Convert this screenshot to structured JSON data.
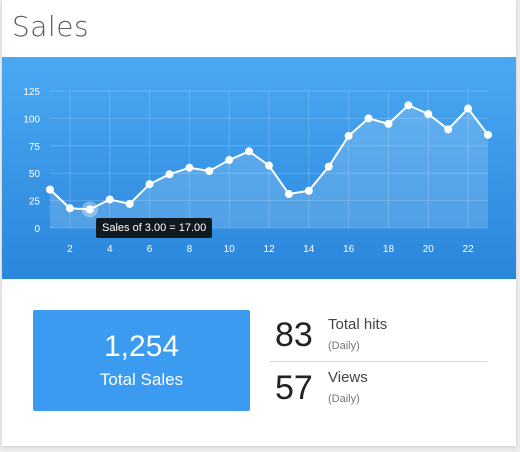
{
  "card": {
    "title": "Sales"
  },
  "chart_data": {
    "type": "area",
    "x": [
      1,
      2,
      3,
      4,
      5,
      6,
      7,
      8,
      9,
      10,
      11,
      12,
      13,
      14,
      15,
      16,
      17,
      18,
      19,
      20,
      21,
      22,
      23
    ],
    "values": [
      35,
      18,
      17,
      26,
      22,
      40,
      49,
      55,
      52,
      62,
      70,
      57,
      31,
      34,
      56,
      84,
      100,
      95,
      112,
      104,
      90,
      109,
      85
    ],
    "x_ticks": [
      2,
      4,
      6,
      8,
      10,
      12,
      14,
      16,
      18,
      20,
      22
    ],
    "y_ticks": [
      0,
      25,
      50,
      75,
      100,
      125
    ],
    "ylim": [
      0,
      125
    ],
    "xlim": [
      1,
      23
    ],
    "grid": true,
    "highlighted_point": {
      "x": 3,
      "y": 17
    },
    "tooltip": "Sales of 3.00 = 17.00",
    "colors": {
      "background_top": "#4aa8f3",
      "background_bottom": "#2a86db",
      "line": "#ffffff"
    }
  },
  "summary": {
    "total_value": "1,254",
    "total_label": "Total Sales"
  },
  "stats": [
    {
      "value": "83",
      "label": "Total hits",
      "sub": "(Daily)"
    },
    {
      "value": "57",
      "label": "Views",
      "sub": "(Daily)"
    }
  ]
}
